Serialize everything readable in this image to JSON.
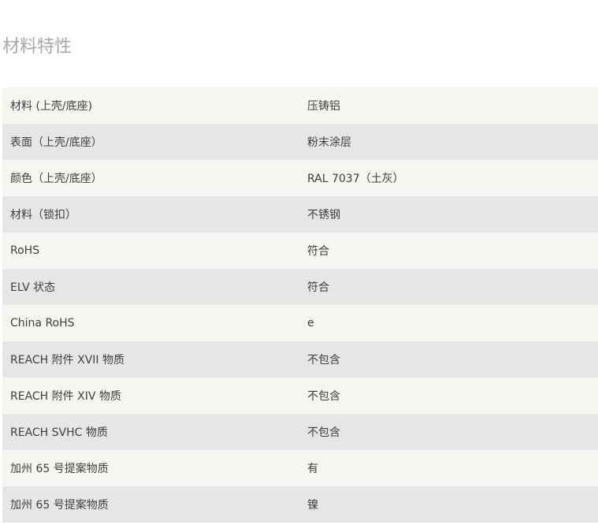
{
  "section": {
    "title": "材料特性"
  },
  "rows": [
    {
      "label": "材料 (上壳/底座)",
      "value": "压铸铝"
    },
    {
      "label": "表面（上壳/底座）",
      "value": "粉末涂层"
    },
    {
      "label": "颜色（上壳/底座）",
      "value": "RAL 7037（土灰）"
    },
    {
      "label": "材料（锁扣）",
      "value": "不锈钢"
    },
    {
      "label": "RoHS",
      "value": "符合"
    },
    {
      "label": "ELV 状态",
      "value": "符合"
    },
    {
      "label": "China RoHS",
      "value": "e"
    },
    {
      "label": "REACH 附件 XVII 物质",
      "value": "不包含"
    },
    {
      "label": "REACH 附件 XIV 物质",
      "value": "不包含"
    },
    {
      "label": "REACH SVHC 物质",
      "value": "不包含"
    },
    {
      "label": "加州 65 号提案物质",
      "value": "有"
    },
    {
      "label": "加州 65 号提案物质",
      "value": "镍"
    }
  ]
}
